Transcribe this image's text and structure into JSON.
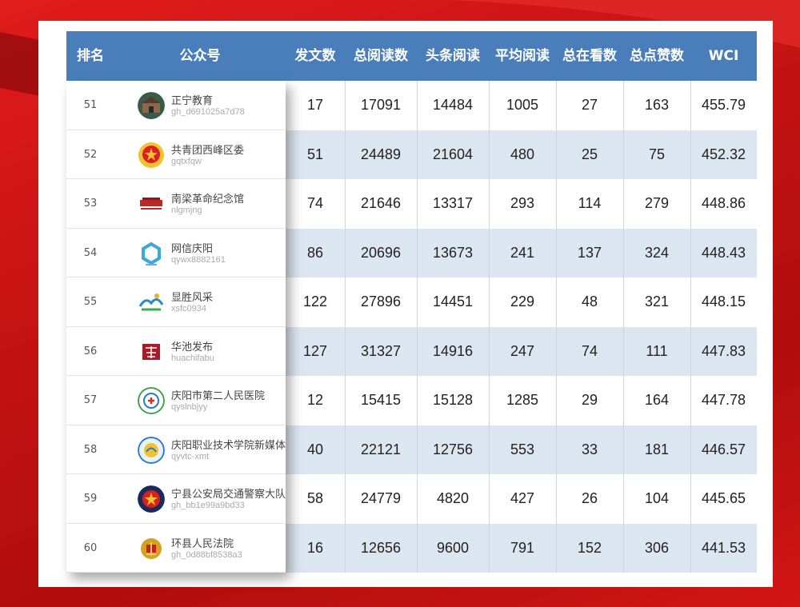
{
  "headers": {
    "rank": "排名",
    "account": "公众号",
    "posts": "发文数",
    "total_reads": "总阅读数",
    "headline_reads": "头条阅读",
    "avg_reads": "平均阅读",
    "total_watching": "总在看数",
    "total_likes": "总点赞数",
    "wci": "WCI"
  },
  "rows": [
    {
      "rank": "51",
      "name": "正宁教育",
      "id": "gh_d691025a7d78",
      "posts": "17",
      "total_reads": "17091",
      "headline_reads": "14484",
      "avg_reads": "1005",
      "watching": "27",
      "likes": "163",
      "wci": "455.79",
      "icon": "school-building-avatar-icon"
    },
    {
      "rank": "52",
      "name": "共青团西峰区委",
      "id": "gqtxfqw",
      "posts": "51",
      "total_reads": "24489",
      "headline_reads": "21604",
      "avg_reads": "480",
      "watching": "25",
      "likes": "75",
      "wci": "452.32",
      "icon": "youth-league-emblem-icon"
    },
    {
      "rank": "53",
      "name": "南梁革命纪念馆",
      "id": "nlgmjng",
      "posts": "74",
      "total_reads": "21646",
      "headline_reads": "13317",
      "avg_reads": "293",
      "watching": "114",
      "likes": "279",
      "wci": "448.86",
      "icon": "memorial-hall-icon"
    },
    {
      "rank": "54",
      "name": "网信庆阳",
      "id": "qywx8882161",
      "posts": "86",
      "total_reads": "20696",
      "headline_reads": "13673",
      "avg_reads": "241",
      "watching": "137",
      "likes": "324",
      "wci": "448.43",
      "icon": "hexagon-logo-icon"
    },
    {
      "rank": "55",
      "name": "显胜风采",
      "id": "xsfc0934",
      "posts": "122",
      "total_reads": "27896",
      "headline_reads": "14451",
      "avg_reads": "229",
      "watching": "48",
      "likes": "321",
      "wci": "448.15",
      "icon": "landscape-logo-icon"
    },
    {
      "rank": "56",
      "name": "华池发布",
      "id": "huachifabu",
      "posts": "127",
      "total_reads": "31327",
      "headline_reads": "14916",
      "avg_reads": "247",
      "watching": "74",
      "likes": "111",
      "wci": "447.83",
      "icon": "calligraphy-seal-icon"
    },
    {
      "rank": "57",
      "name": "庆阳市第二人民医院",
      "id": "qyslnbjyy",
      "posts": "12",
      "total_reads": "15415",
      "headline_reads": "15128",
      "avg_reads": "1285",
      "watching": "29",
      "likes": "164",
      "wci": "447.78",
      "icon": "hospital-logo-icon"
    },
    {
      "rank": "58",
      "name": "庆阳职业技术学院新媒体",
      "id": "qyvtc-xmt",
      "posts": "40",
      "total_reads": "22121",
      "headline_reads": "12756",
      "avg_reads": "553",
      "watching": "33",
      "likes": "181",
      "wci": "446.57",
      "icon": "college-emblem-icon"
    },
    {
      "rank": "59",
      "name": "宁县公安局交通警察大队",
      "id": "gh_bb1e99a9bd33",
      "posts": "58",
      "total_reads": "24779",
      "headline_reads": "4820",
      "avg_reads": "427",
      "watching": "26",
      "likes": "104",
      "wci": "445.65",
      "icon": "police-badge-icon"
    },
    {
      "rank": "60",
      "name": "环县人民法院",
      "id": "gh_0d88bf8538a3",
      "posts": "16",
      "total_reads": "12656",
      "headline_reads": "9600",
      "avg_reads": "791",
      "watching": "152",
      "likes": "306",
      "wci": "441.53",
      "icon": "court-emblem-icon"
    }
  ],
  "colors": {
    "header_bg": "#4a7ebb",
    "row_alt_bg": "#dce6f1",
    "background_red": "#c41212"
  }
}
